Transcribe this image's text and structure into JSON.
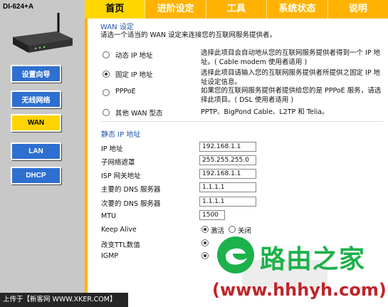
{
  "sidebar": {
    "model": "DI-624+A",
    "items": [
      {
        "label": "设置向导",
        "active": false
      },
      {
        "label": "无线网络",
        "active": false
      },
      {
        "label": "WAN",
        "active": true
      },
      {
        "label": "LAN",
        "active": false
      },
      {
        "label": "DHCP",
        "active": false
      }
    ]
  },
  "tabs": [
    "首页",
    "进阶设定",
    "工具",
    "系统状态",
    "说明"
  ],
  "wan": {
    "title": "WAN 设定",
    "description": "请选一个适当的 WAN 设定来连接您的互联网服务提供者。",
    "options": [
      {
        "label": "动态 IP 地址",
        "desc_line1": "选择此项目会自动地从您的互联网服务提供者得到一个 IP 地",
        "desc_line2": "址。( Cable modem 使用者适用 )",
        "selected": false
      },
      {
        "label": "固定 IP 地址",
        "desc_line1": "选择此项目请输入您的互联网服务提供者所提供之固定 IP 地",
        "desc_line2": "址设定信息。",
        "selected": true
      },
      {
        "label": "PPPoE",
        "desc_line1": "如果您的互联网服务提供者提供给您的是 PPPoE 服务，请选",
        "desc_line2": "择此项目。( DSL 使用者适用 )",
        "selected": false
      },
      {
        "label": "其他 WAN 型态",
        "desc_line1": "PPTP、BigPond Cable、L2TP 和 Telia。",
        "desc_line2": "",
        "selected": false
      }
    ]
  },
  "static_ip": {
    "title": "静态 IP 地址",
    "fields": [
      {
        "label": "IP 地址",
        "value": "192.168.1.1"
      },
      {
        "label": "子网络遮罩",
        "value": "255.255.255.0"
      },
      {
        "label": "ISP 网关地址",
        "value": "192.168.1.1"
      },
      {
        "label": "主要的 DNS 服务器",
        "value": "1.1.1.1"
      },
      {
        "label": "次要的 DNS 服务器",
        "value": "1.1.1.1"
      },
      {
        "label": "MTU",
        "value": "1500"
      }
    ],
    "keep_alive": {
      "label": "Keep Alive",
      "on": "激活",
      "off": "关闭"
    },
    "ttl": {
      "label": "改变TTL数值",
      "on": "激活"
    },
    "igmp": {
      "label": "IGMP"
    }
  },
  "footer": "上传于【新客网 WWW.XKER.COM】",
  "watermark": {
    "text": "路由之家",
    "url": "(www.hhhyh.com)"
  }
}
